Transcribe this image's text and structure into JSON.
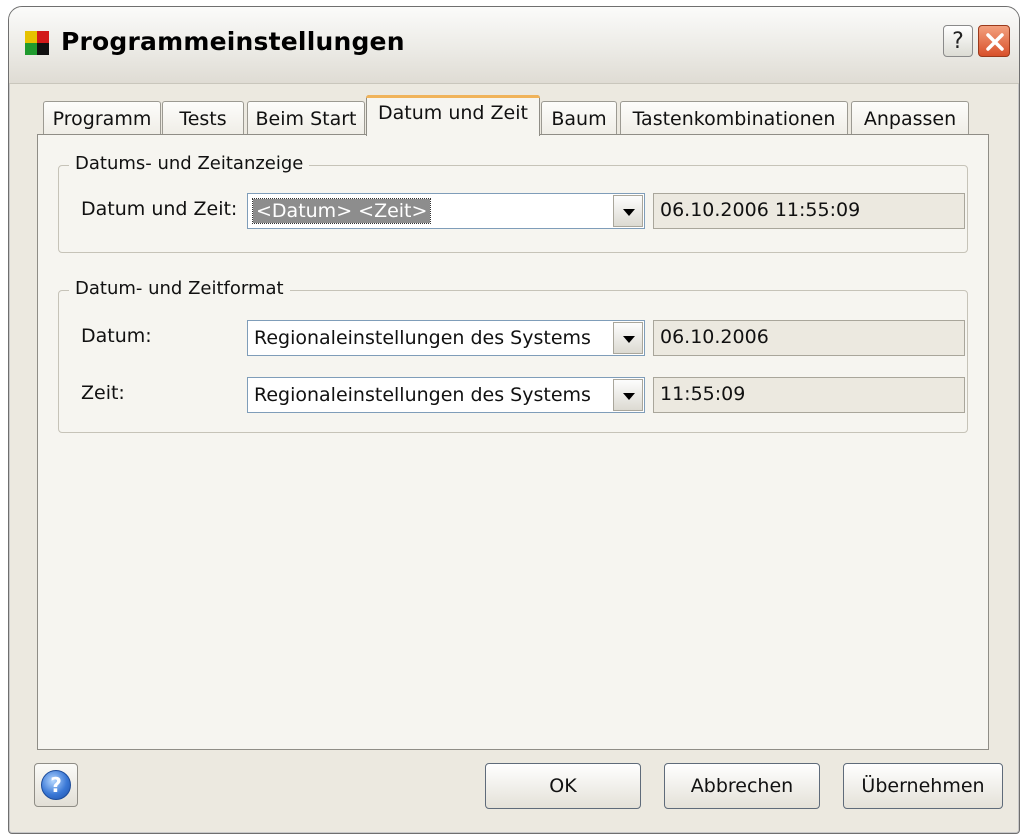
{
  "window": {
    "title": "Programmeinstellungen",
    "help_glyph": "?",
    "icons": {
      "app": "app-logo-icon",
      "help": "question-icon",
      "close": "close-icon"
    }
  },
  "tabs": [
    {
      "label": "Programm",
      "active": false
    },
    {
      "label": "Tests",
      "active": false
    },
    {
      "label": "Beim Start",
      "active": false
    },
    {
      "label": "Datum und Zeit",
      "active": true
    },
    {
      "label": "Baum",
      "active": false
    },
    {
      "label": "Tastenkombinationen",
      "active": false
    },
    {
      "label": "Anpassen",
      "active": false
    }
  ],
  "display_group": {
    "legend": "Datums- und Zeitanzeige",
    "label": "Datum und Zeit:",
    "selected": "<Datum> <Zeit>",
    "preview": "06.10.2006 11:55:09"
  },
  "format_group": {
    "legend": "Datum- und Zeitformat",
    "date_label": "Datum:",
    "date_selected": "Regionaleinstellungen des Systems",
    "date_preview": "06.10.2006",
    "time_label": "Zeit:",
    "time_selected": "Regionaleinstellungen des Systems",
    "time_preview": "11:55:09"
  },
  "buttons": {
    "help_glyph": "?",
    "ok": "OK",
    "cancel": "Abbrechen",
    "apply": "Übernehmen"
  },
  "colors": {
    "dialog_bg": "#ece9e0",
    "active_tab_accent": "#f0b35a",
    "close_button": "#d8502a",
    "selection": "#8d8d8d"
  }
}
